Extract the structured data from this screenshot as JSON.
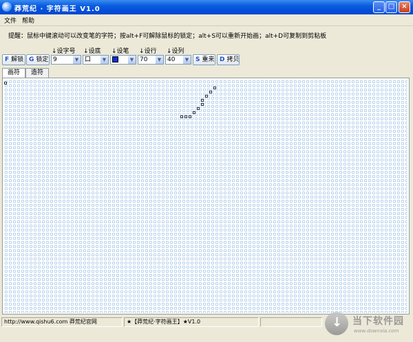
{
  "window": {
    "title": "莽荒纪 · 字符画王  V1.0",
    "controls": {
      "minimize": "_",
      "maximize": "□",
      "close": "×"
    }
  },
  "menu": {
    "items": [
      "文件",
      "帮助"
    ]
  },
  "hint": "提醒：鼠标中键滚动可以改变笔的字符；按alt+F可解除鼠标的锁定；alt+S可以重新开始画；alt+D可复制到剪粘板",
  "toolbar": {
    "unlock": {
      "icon": "F",
      "label": "解锁"
    },
    "lock": {
      "icon": "G",
      "label": "锁定"
    },
    "font_size": {
      "label": "↓设字号",
      "value": "9"
    },
    "background": {
      "label": "↓设底",
      "value": "口"
    },
    "pen": {
      "label": "↓设笔",
      "value": "■"
    },
    "rows": {
      "label": "↓设行",
      "value": "70"
    },
    "cols": {
      "label": "↓设列",
      "value": "40"
    },
    "reset": {
      "icon": "S",
      "label": "重来"
    },
    "copy": {
      "icon": "D",
      "label": "拷贝"
    },
    "dropdown_icon": "▼"
  },
  "tabs": [
    "画符",
    "造符"
  ],
  "status": {
    "url": "http://www.qishu6.com   莽荒纪官网",
    "product": "★【莽荒纪·字符画王】★V1.0",
    "extra": ""
  },
  "watermark": {
    "name": "当下软件园",
    "sub": "www.downxia.com"
  },
  "colors": {
    "title_bar": "#0a5ce0",
    "grid_cell": "#a9c8e8",
    "pen": "#1030d0"
  }
}
